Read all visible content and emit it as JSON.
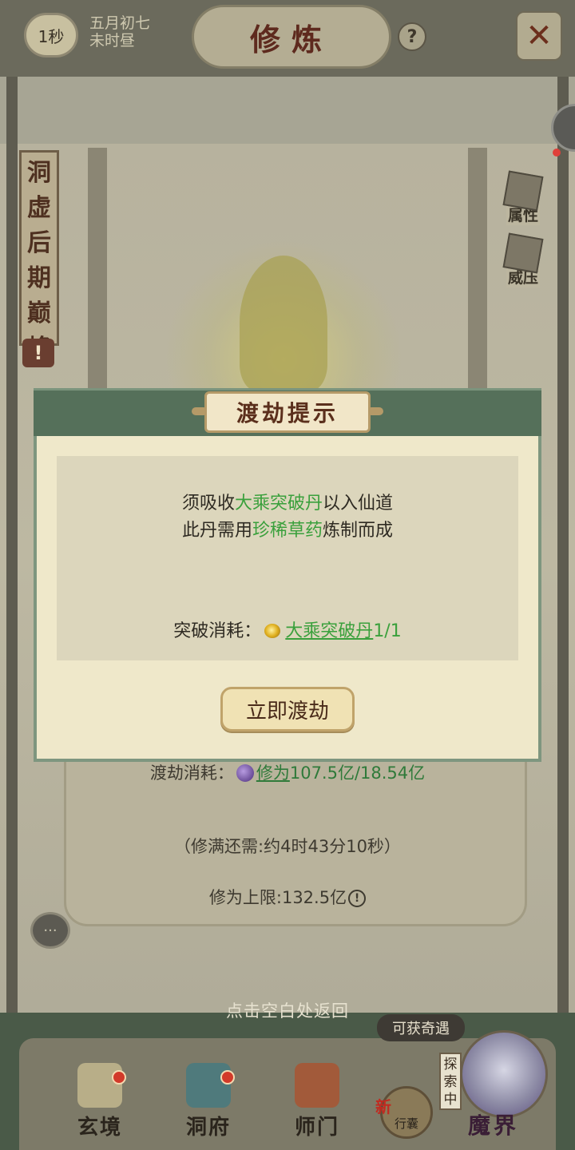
{
  "topbar": {
    "timer": "1秒",
    "lunar_date": "五月初七",
    "lunar_time": "未时昼",
    "title": "修炼",
    "help": "?",
    "close": "✕"
  },
  "realm": {
    "name": "洞虚后期巅峰",
    "warning": "!"
  },
  "side_buttons": {
    "attributes": "属性",
    "pressure": "威压"
  },
  "modal": {
    "title": "渡劫提示",
    "line1": {
      "prefix": "须吸收",
      "highlight": "大乘突破丹",
      "suffix": "以入仙道"
    },
    "line2": {
      "prefix": "此丹需用",
      "highlight": "珍稀草药",
      "suffix": "炼制而成"
    },
    "cost": {
      "label": "突破消耗：",
      "item": "大乘突破丹",
      "amount": "1/1"
    },
    "confirm_button": "立即渡劫"
  },
  "underlay": {
    "tribulation_cost_label": "渡劫消耗：",
    "cultivation_link": "修为",
    "cultivation_amount": "107.5亿/18.54亿",
    "remaining": "（修满还需:约4时43分10秒）",
    "cap_label": "修为上限:132.5亿",
    "cap_warning": "!"
  },
  "tap_return": "点击空白处返回",
  "bottom_nav": {
    "items": [
      {
        "label": "玄境"
      },
      {
        "label": "洞府"
      },
      {
        "label": "师门"
      }
    ],
    "bag_label": "行囊",
    "new_tag": "新",
    "encounter": "可获奇遇",
    "exploring": "探索中",
    "demon_realm": "魔界"
  },
  "colors": {
    "highlight_green": "#3aa03c",
    "modal_band": "#55705a",
    "modal_body": "#efe8ca",
    "title_red": "#5e2a1e",
    "badge_red": "#d23a2a"
  }
}
